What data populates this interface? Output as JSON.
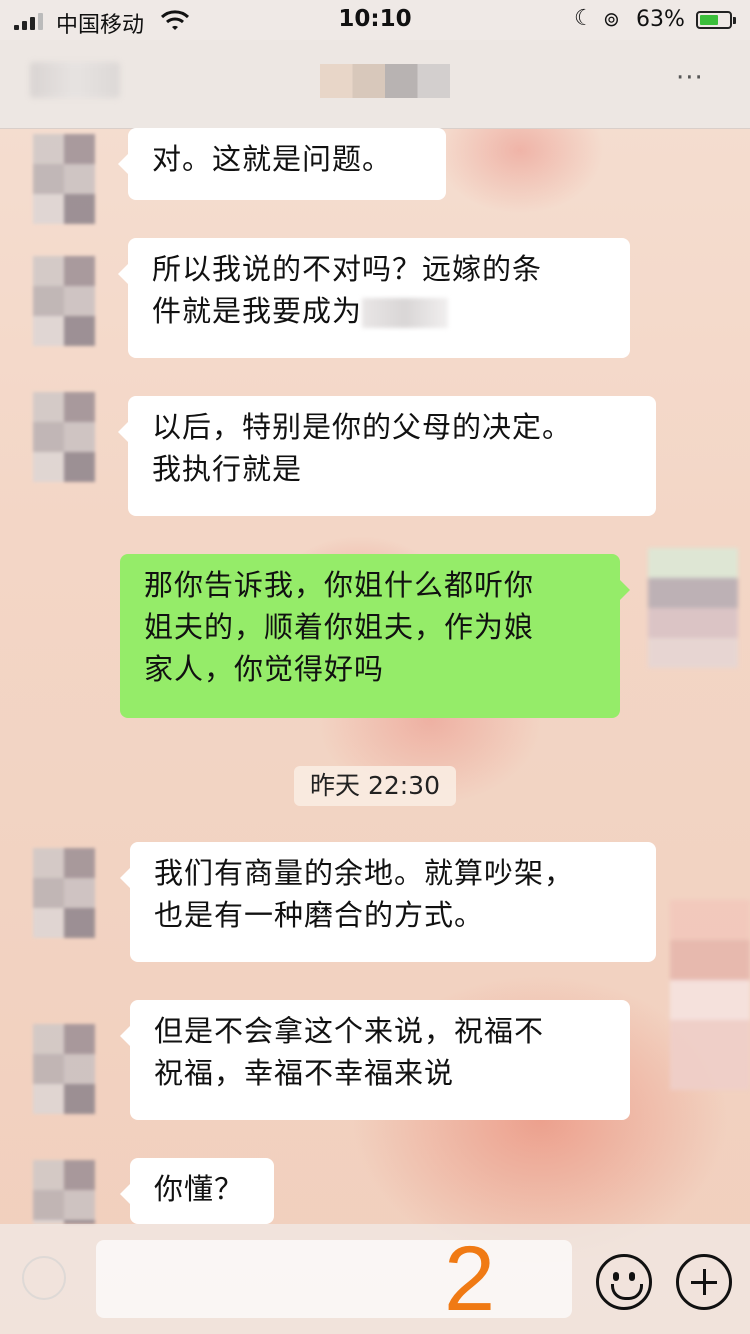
{
  "status_bar": {
    "carrier": "中国移动",
    "time": "10:10",
    "battery_percent": "63%",
    "battery_level": 0.63
  },
  "nav": {
    "more_label": "···"
  },
  "messages": [
    {
      "side": "left",
      "text": "对。这就是问题。"
    },
    {
      "side": "left",
      "line1": "所以我说的不对吗？远嫁的条",
      "line2": "件就是我要成为"
    },
    {
      "side": "left",
      "line1": "以后，特别是你的父母的决定。",
      "line2": "我执行就是"
    },
    {
      "side": "right",
      "line1": "那你告诉我，你姐什么都听你",
      "line2": "姐夫的，顺着你姐夫，作为娘",
      "line3": "家人，你觉得好吗"
    },
    {
      "side": "left",
      "line1": "我们有商量的余地。就算吵架，",
      "line2": "也是有一种磨合的方式。"
    },
    {
      "side": "left",
      "line1": "但是不会拿这个来说，祝福不",
      "line2": "祝福，幸福不幸福来说"
    },
    {
      "side": "left",
      "text": "你懂？"
    }
  ],
  "timestamp": "昨天 22:30",
  "input_bar": {
    "annotation": "2",
    "annotation_color": "#f07a14",
    "my_bubble_color": "#95ec69"
  }
}
